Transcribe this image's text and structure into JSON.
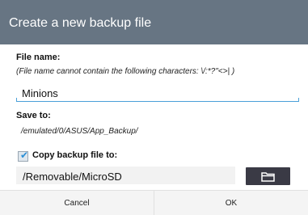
{
  "dialog": {
    "title": "Create a new backup file",
    "file_name_label": "File name:",
    "file_name_note": "(File name cannot contain the following characters: \\/:*?\"<>| )",
    "file_name_value": "Minions",
    "save_to_label": "Save to:",
    "save_to_path": "/emulated/0/ASUS/App_Backup/",
    "copy_checkbox": {
      "label": "Copy backup file to:",
      "checked": true
    },
    "copy_destination": "/Removable/MicroSD",
    "folder_button_icon": "folder-icon",
    "cancel_label": "Cancel",
    "ok_label": "OK"
  },
  "colors": {
    "title_bar": "#677583",
    "accent": "#4aa0d8",
    "folder_button": "#3a3a45"
  }
}
